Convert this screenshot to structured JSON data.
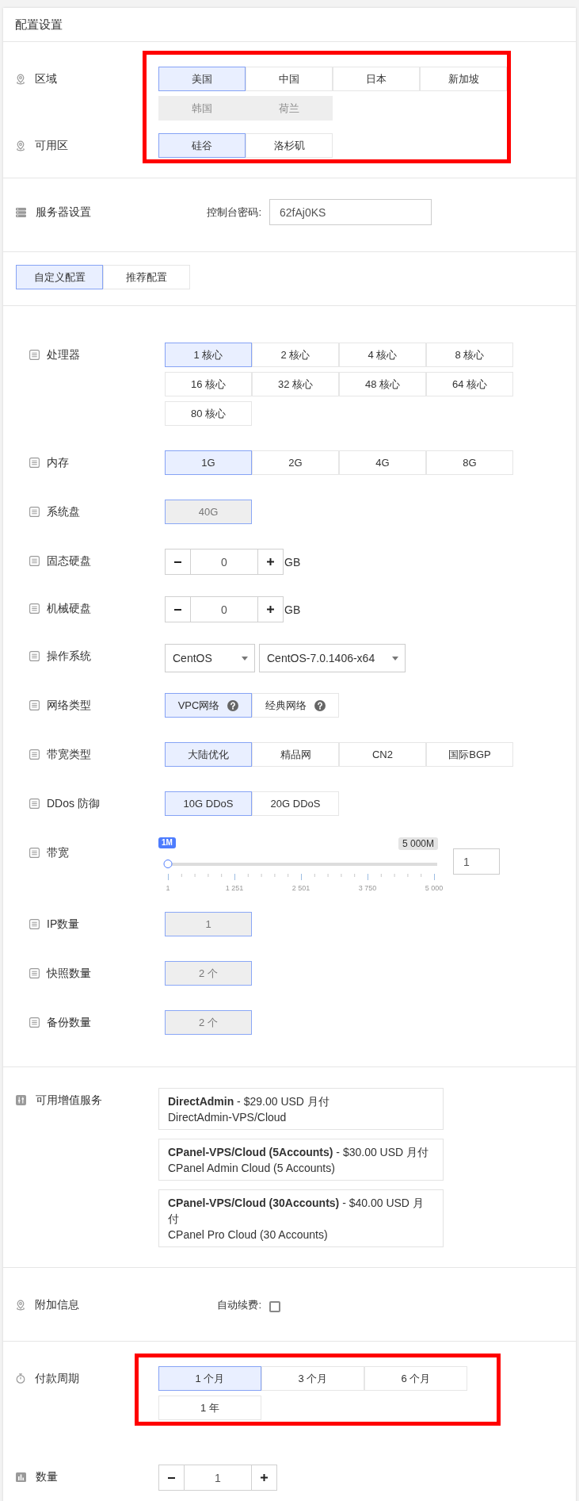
{
  "header": {
    "title": "配置设置"
  },
  "region": {
    "groups": [
      {
        "label": "区域",
        "options": [
          {
            "label": "美国",
            "selected": true,
            "disabled": false
          },
          {
            "label": "中国",
            "selected": false,
            "disabled": false
          },
          {
            "label": "日本",
            "selected": false,
            "disabled": false
          },
          {
            "label": "新加坡",
            "selected": false,
            "disabled": false
          },
          {
            "label": "韩国",
            "selected": false,
            "disabled": true
          },
          {
            "label": "荷兰",
            "selected": false,
            "disabled": true
          }
        ]
      },
      {
        "label": "可用区",
        "options": [
          {
            "label": "硅谷",
            "selected": true,
            "disabled": false
          },
          {
            "label": "洛杉矶",
            "selected": false,
            "disabled": false
          }
        ]
      }
    ]
  },
  "server": {
    "label": "服务器设置",
    "field_label": "控制台密码:",
    "password": "62fAj0KS"
  },
  "config_tabs": [
    {
      "label": "自定义配置",
      "selected": true
    },
    {
      "label": "推荐配置",
      "selected": false
    }
  ],
  "config": {
    "rows": [
      {
        "kind": "options",
        "label": "处理器",
        "options": [
          {
            "label": "1 核心",
            "selected": true,
            "disabled": false
          },
          {
            "label": "2 核心",
            "selected": false,
            "disabled": false
          },
          {
            "label": "4 核心",
            "selected": false,
            "disabled": false
          },
          {
            "label": "8 核心",
            "selected": false,
            "disabled": false
          },
          {
            "label": "16 核心",
            "selected": false,
            "disabled": false
          },
          {
            "label": "32 核心",
            "selected": false,
            "disabled": false
          },
          {
            "label": "48 核心",
            "selected": false,
            "disabled": false
          },
          {
            "label": "64 核心",
            "selected": false,
            "disabled": false
          },
          {
            "label": "80 核心",
            "selected": false,
            "disabled": false
          }
        ]
      },
      {
        "kind": "options",
        "label": "内存",
        "options": [
          {
            "label": "1G",
            "selected": true,
            "disabled": false
          },
          {
            "label": "2G",
            "selected": false,
            "disabled": false
          },
          {
            "label": "4G",
            "selected": false,
            "disabled": false
          },
          {
            "label": "8G",
            "selected": false,
            "disabled": false
          }
        ]
      },
      {
        "kind": "options",
        "label": "系统盘",
        "options": [
          {
            "label": "40G",
            "selected": true,
            "disabled": true
          }
        ]
      },
      {
        "kind": "stepper",
        "label": "固态硬盘",
        "value": "0",
        "unit": "GB"
      },
      {
        "kind": "stepper",
        "label": "机械硬盘",
        "value": "0",
        "unit": "GB"
      },
      {
        "kind": "selects",
        "label": "操作系统",
        "selects": [
          {
            "value": "CentOS"
          },
          {
            "value": "CentOS-7.0.1406-x64"
          }
        ]
      },
      {
        "kind": "options",
        "label": "网络类型",
        "options": [
          {
            "label": "VPC网络",
            "selected": true,
            "disabled": false,
            "help": true
          },
          {
            "label": "经典网络",
            "selected": false,
            "disabled": false,
            "help": true
          }
        ]
      },
      {
        "kind": "options",
        "label": "带宽类型",
        "options": [
          {
            "label": "大陆优化",
            "selected": true,
            "disabled": false
          },
          {
            "label": "精品网",
            "selected": false,
            "disabled": false
          },
          {
            "label": "CN2",
            "selected": false,
            "disabled": false
          },
          {
            "label": "国际BGP",
            "selected": false,
            "disabled": false
          }
        ]
      },
      {
        "kind": "options",
        "label": "DDos 防御",
        "options": [
          {
            "label": "10G DDoS",
            "selected": true,
            "disabled": false
          },
          {
            "label": "20G DDoS",
            "selected": false,
            "disabled": false
          }
        ]
      },
      {
        "kind": "slider",
        "label": "带宽",
        "level": 0,
        "value_badge": "1M",
        "max_badge": "5 000M",
        "ticks": [
          "1",
          "1 251",
          "2 501",
          "3 750",
          "5 000"
        ],
        "value": "1"
      },
      {
        "kind": "options",
        "label": "IP数量",
        "options": [
          {
            "label": "1",
            "selected": true,
            "disabled": true
          }
        ]
      },
      {
        "kind": "options",
        "label": "快照数量",
        "options": [
          {
            "label": "2 个",
            "selected": true,
            "disabled": true
          }
        ]
      },
      {
        "kind": "options",
        "label": "备份数量",
        "options": [
          {
            "label": "2 个",
            "selected": true,
            "disabled": true
          }
        ]
      }
    ]
  },
  "services": {
    "label": "可用增值服务",
    "items": [
      {
        "title": "**DirectAdmin** - $29.00 USD 月付",
        "description": "DirectAdmin-VPS/Cloud"
      },
      {
        "title": "**CPanel-VPS/Cloud (5Accounts)** - $30.00 USD 月付",
        "description": "CPanel Admin Cloud (5 Accounts)"
      },
      {
        "title": "**CPanel-VPS/Cloud (30Accounts)** - $40.00 USD 月付",
        "description": "CPanel Pro Cloud (30 Accounts)"
      }
    ]
  },
  "extra": {
    "label": "附加信息",
    "auto_renew": {
      "label": "自动续费:",
      "checked": false
    }
  },
  "billing": {
    "label": "付款周期",
    "options": [
      {
        "label": "1 个月",
        "selected": true
      },
      {
        "label": "3 个月",
        "selected": false
      },
      {
        "label": "6 个月",
        "selected": false
      },
      {
        "label": "1 年",
        "selected": false
      }
    ]
  },
  "quantity": {
    "label": "数量",
    "value": "1"
  }
}
